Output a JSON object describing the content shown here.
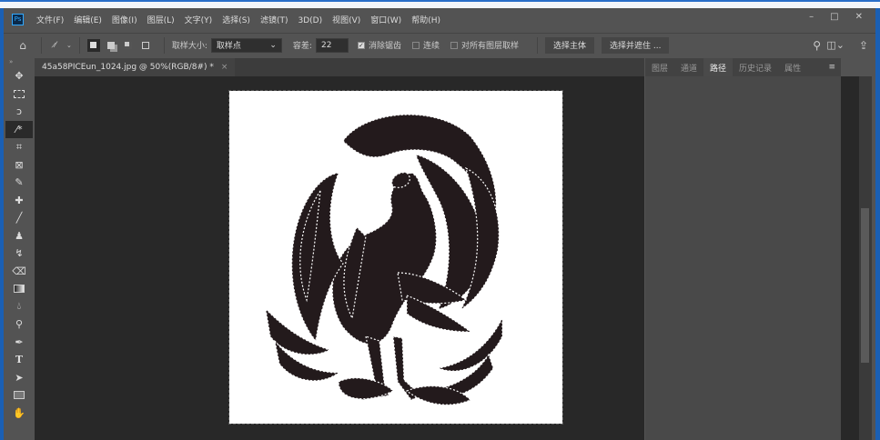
{
  "app": {
    "logo": "Ps"
  },
  "menu": [
    "文件(F)",
    "编辑(E)",
    "图像(I)",
    "图层(L)",
    "文字(Y)",
    "选择(S)",
    "滤镜(T)",
    "3D(D)",
    "视图(V)",
    "窗口(W)",
    "帮助(H)"
  ],
  "window_controls": {
    "minimize": "–",
    "maximize": "□",
    "close": "✕"
  },
  "options": {
    "sample_size_label": "取样大小:",
    "sample_size_value": "取样点",
    "tolerance_label": "容差:",
    "tolerance_value": "22",
    "antialias_label": "消除锯齿",
    "antialias_checked": true,
    "contiguous_label": "连续",
    "contiguous_checked": false,
    "all_layers_label": "对所有图层取样",
    "all_layers_checked": false,
    "select_subject": "选择主体",
    "select_mask": "选择并遮住 ..."
  },
  "document_tab": {
    "title": "45a58PICEun_1024.jpg @ 50%(RGB/8#) *",
    "close": "×"
  },
  "panel": {
    "tabs": [
      "图层",
      "通道",
      "路径",
      "历史记录",
      "属性"
    ],
    "active_tab": "路径",
    "menu": "≡"
  },
  "tools": [
    "move",
    "marquee",
    "lasso",
    "magic-wand",
    "crop",
    "frame",
    "eyedropper",
    "healing",
    "brush",
    "stamp",
    "history-brush",
    "eraser",
    "gradient",
    "blur",
    "dodge",
    "pen",
    "type",
    "path-select",
    "rectangle",
    "hand"
  ]
}
